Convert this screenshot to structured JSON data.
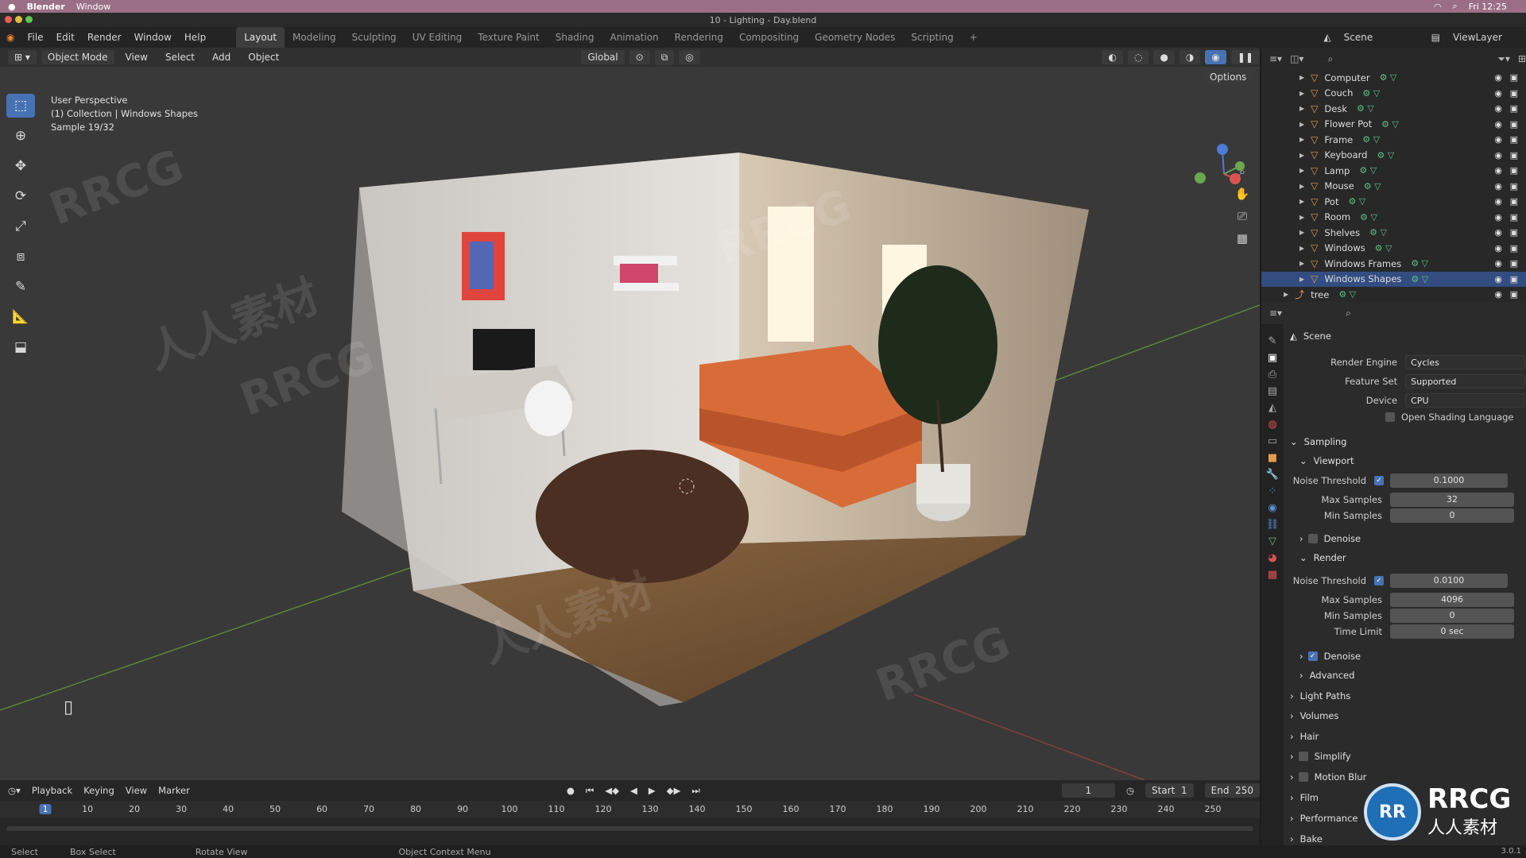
{
  "mac": {
    "app": "Blender",
    "menu": "Window",
    "clock": "Fri 12:25"
  },
  "window_title": "10 - Lighting - Day.blend",
  "menus": [
    "File",
    "Edit",
    "Render",
    "Window",
    "Help"
  ],
  "workspaces": [
    "Layout",
    "Modeling",
    "Sculpting",
    "UV Editing",
    "Texture Paint",
    "Shading",
    "Animation",
    "Rendering",
    "Compositing",
    "Geometry Nodes",
    "Scripting"
  ],
  "scene_name": "Scene",
  "view_layer": "ViewLayer",
  "viewport_header": {
    "mode": "Object Mode",
    "menus": [
      "View",
      "Select",
      "Add",
      "Object"
    ],
    "transform": "Global",
    "options": "Options"
  },
  "viewport_info": {
    "line1": "User Perspective",
    "line2": "(1) Collection | Windows Shapes",
    "line3": "Sample 19/32"
  },
  "outliner": [
    {
      "name": "Computer"
    },
    {
      "name": "Couch"
    },
    {
      "name": "Desk"
    },
    {
      "name": "Flower Pot"
    },
    {
      "name": "Frame"
    },
    {
      "name": "Keyboard"
    },
    {
      "name": "Lamp"
    },
    {
      "name": "Mouse"
    },
    {
      "name": "Pot"
    },
    {
      "name": "Room"
    },
    {
      "name": "Shelves"
    },
    {
      "name": "Windows"
    },
    {
      "name": "Windows Frames"
    },
    {
      "name": "Windows Shapes",
      "selected": true
    },
    {
      "name": "tree"
    }
  ],
  "properties": {
    "context": "Scene",
    "render_engine_label": "Render Engine",
    "render_engine": "Cycles",
    "feature_set_label": "Feature Set",
    "feature_set": "Supported",
    "device_label": "Device",
    "device": "CPU",
    "osl": "Open Shading Language",
    "sampling": "Sampling",
    "viewport": "Viewport",
    "noise_threshold_label": "Noise Threshold",
    "vp_noise": "0.1000",
    "max_samples_label": "Max Samples",
    "vp_max": "32",
    "min_samples_label": "Min Samples",
    "vp_min": "0",
    "denoise": "Denoise",
    "render": "Render",
    "r_noise": "0.0100",
    "r_max": "4096",
    "r_min": "0",
    "time_limit_label": "Time Limit",
    "r_time": "0 sec",
    "advanced": "Advanced",
    "panels": [
      "Light Paths",
      "Volumes",
      "Hair",
      "Simplify",
      "Motion Blur",
      "Film",
      "Performance",
      "Bake"
    ]
  },
  "timeline": {
    "menus": [
      "Playback",
      "Keying",
      "View",
      "Marker"
    ],
    "current": "1",
    "start_label": "Start",
    "start": "1",
    "end_label": "End",
    "end": "250",
    "ticks": [
      "1",
      "10",
      "20",
      "30",
      "40",
      "50",
      "60",
      "70",
      "80",
      "90",
      "100",
      "110",
      "120",
      "130",
      "140",
      "150",
      "160",
      "170",
      "180",
      "190",
      "200",
      "210",
      "220",
      "230",
      "240",
      "250"
    ]
  },
  "status": {
    "select": "Select",
    "box": "Box Select",
    "rotate": "Rotate View",
    "context": "Object Context Menu",
    "version": "3.0.1"
  },
  "watermark": {
    "text": "RRCG",
    "sub": "人人素材"
  }
}
